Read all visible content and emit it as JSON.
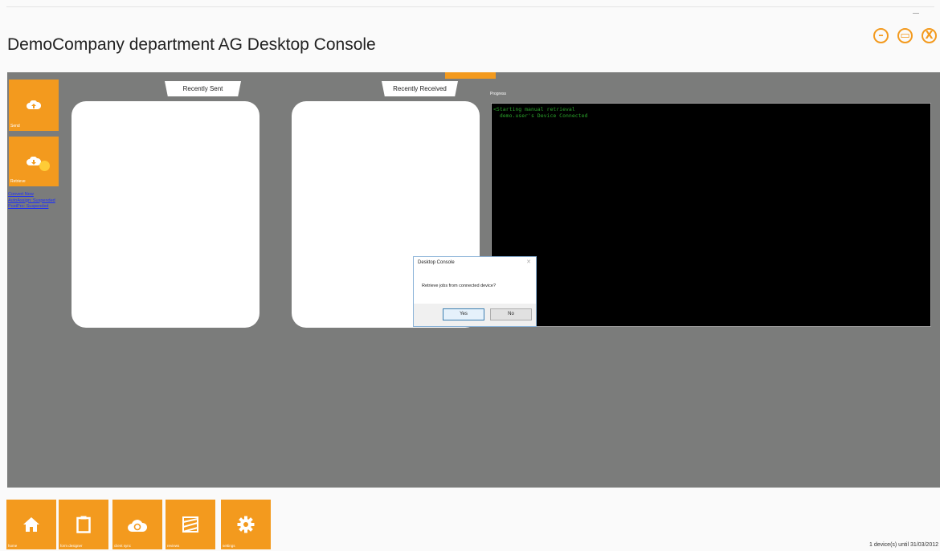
{
  "app": {
    "title": "DemoCompany department AG Desktop Console"
  },
  "window_controls": {
    "minimize_glyph": "–",
    "maximize_glyph": "▭",
    "close_glyph": "X"
  },
  "sidebar": {
    "tiles": [
      {
        "label": "Send",
        "icon": "cloud-upload-icon"
      },
      {
        "label": "Retrieve",
        "icon": "cloud-download-icon"
      }
    ],
    "links": [
      "Convert Now",
      "AutoAssign: Suspended",
      "PostPro: Suspended"
    ]
  },
  "panels": {
    "recently_sent": "Recently Sent",
    "recently_received": "Recently Received"
  },
  "progress": {
    "label": "Progress",
    "lines": [
      "<Starting manual retrieval",
      "  demo.user's Device Connected"
    ]
  },
  "dialog": {
    "title": "Desktop Console",
    "message": "Retrieve jobs from connected device?",
    "yes": "Yes",
    "no": "No"
  },
  "bottom_nav": [
    {
      "label": "home",
      "icon": "home-icon"
    },
    {
      "label": "form designer",
      "icon": "clipboard-icon"
    },
    {
      "label": "client sync",
      "icon": "cloud-sync-icon"
    },
    {
      "label": "reviews",
      "icon": "map-icon"
    },
    {
      "label": "settings",
      "icon": "gear-icon"
    }
  ],
  "status": "1 device(s) until 31/03/2012",
  "colors": {
    "accent": "#f39a1e",
    "workspace": "#7b7c7b",
    "console_bg": "#000000",
    "console_text": "#2ba32b"
  }
}
